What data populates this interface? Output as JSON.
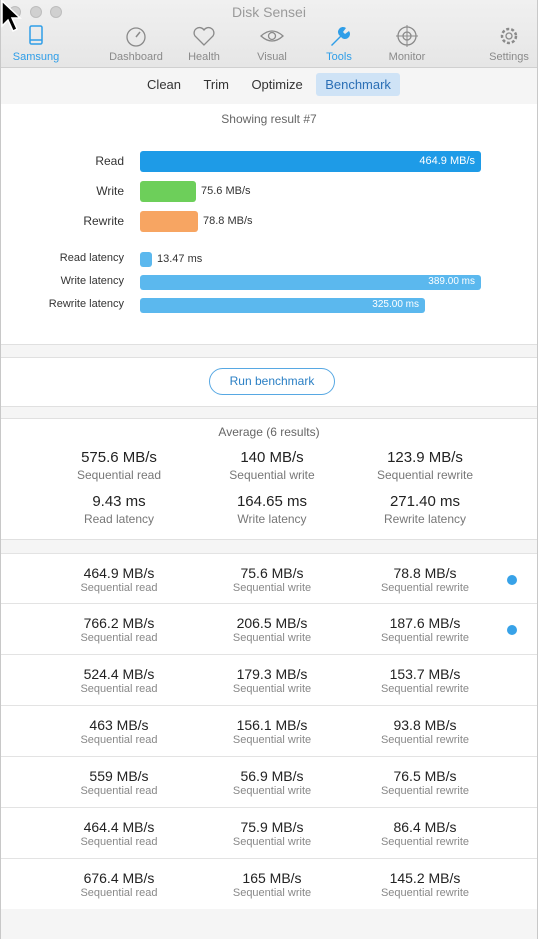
{
  "app": {
    "title": "Disk Sensei"
  },
  "toolbar": {
    "items": [
      {
        "label": "Samsung",
        "icon": "drive-icon",
        "active": true
      },
      {
        "label": "Dashboard",
        "icon": "speedometer-icon"
      },
      {
        "label": "Health",
        "icon": "heart-icon"
      },
      {
        "label": "Visual",
        "icon": "eye-icon"
      },
      {
        "label": "Tools",
        "icon": "wrench-icon",
        "active": true
      },
      {
        "label": "Monitor",
        "icon": "monitor-target-icon"
      },
      {
        "label": "Settings",
        "icon": "gear-icon"
      }
    ]
  },
  "tabs": [
    "Clean",
    "Trim",
    "Optimize",
    "Benchmark"
  ],
  "active_tab": "Benchmark",
  "result": {
    "showing": "Showing result #7",
    "bars": [
      {
        "label": "Read",
        "value": "464.9 MB/s",
        "fraction": 1.0,
        "color": "#1e9be7"
      },
      {
        "label": "Write",
        "value": "75.6 MB/s",
        "fraction": 0.163,
        "color": "#6dcf5a"
      },
      {
        "label": "Rewrite",
        "value": "78.8 MB/s",
        "fraction": 0.169,
        "color": "#f7a562"
      },
      {
        "label": "Read latency",
        "value": "13.47 ms",
        "fraction": 0.035,
        "color": "#5bb8ee"
      },
      {
        "label": "Write latency",
        "value": "389.00 ms",
        "fraction": 1.0,
        "color": "#5bb8ee"
      },
      {
        "label": "Rewrite latency",
        "value": "325.00 ms",
        "fraction": 0.835,
        "color": "#5bb8ee"
      }
    ]
  },
  "run_button": "Run benchmark",
  "average": {
    "title": "Average (6 results)",
    "cells": [
      {
        "value": "575.6 MB/s",
        "label": "Sequential read"
      },
      {
        "value": "140 MB/s",
        "label": "Sequential write"
      },
      {
        "value": "123.9 MB/s",
        "label": "Sequential rewrite"
      },
      {
        "value": "9.43 ms",
        "label": "Read latency"
      },
      {
        "value": "164.65 ms",
        "label": "Write latency"
      },
      {
        "value": "271.40 ms",
        "label": "Rewrite latency"
      }
    ]
  },
  "results": [
    {
      "read": "464.9 MB/s",
      "write": "75.6 MB/s",
      "rewrite": "78.8 MB/s",
      "dot": true
    },
    {
      "read": "766.2 MB/s",
      "write": "206.5 MB/s",
      "rewrite": "187.6 MB/s",
      "dot": true
    },
    {
      "read": "524.4 MB/s",
      "write": "179.3 MB/s",
      "rewrite": "153.7 MB/s",
      "dot": false
    },
    {
      "read": "463 MB/s",
      "write": "156.1 MB/s",
      "rewrite": "93.8 MB/s",
      "dot": false
    },
    {
      "read": "559 MB/s",
      "write": "56.9 MB/s",
      "rewrite": "76.5 MB/s",
      "dot": false
    },
    {
      "read": "464.4 MB/s",
      "write": "75.9 MB/s",
      "rewrite": "86.4 MB/s",
      "dot": false
    },
    {
      "read": "676.4 MB/s",
      "write": "165 MB/s",
      "rewrite": "145.2 MB/s",
      "dot": false
    }
  ],
  "result_labels": {
    "read": "Sequential read",
    "write": "Sequential write",
    "rewrite": "Sequential rewrite"
  }
}
